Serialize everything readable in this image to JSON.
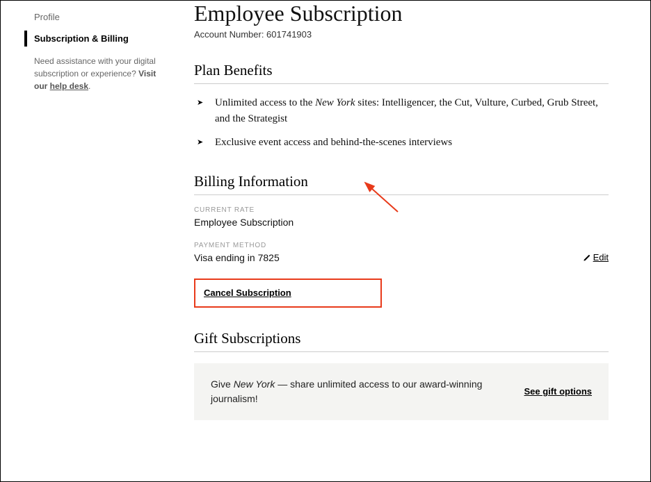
{
  "sidebar": {
    "items": [
      {
        "label": "Profile"
      },
      {
        "label": "Subscription & Billing"
      }
    ],
    "help_prefix": "Need assistance with your digital subscription or experience? ",
    "help_bold": "Visit our ",
    "help_link": "help desk"
  },
  "page": {
    "title": "Employee Subscription",
    "account_label": "Account Number: ",
    "account_number": "601741903"
  },
  "benefits": {
    "heading": "Plan Benefits",
    "items": [
      {
        "prefix": "Unlimited access to the ",
        "em": "New York",
        "suffix": " sites: Intelligencer, the Cut, Vulture, Curbed, Grub Street, and the Strategist"
      },
      {
        "prefix": "Exclusive event access and behind-the-scenes interviews",
        "em": "",
        "suffix": ""
      }
    ]
  },
  "billing": {
    "heading": "Billing Information",
    "rate_label": "CURRENT RATE",
    "rate_value": "Employee Subscription",
    "payment_label": "PAYMENT METHOD",
    "payment_value": "Visa ending in 7825",
    "edit_label": "Edit",
    "cancel_label": "Cancel Subscription"
  },
  "gift": {
    "heading": "Gift Subscriptions",
    "text_prefix": "Give ",
    "text_em": "New York",
    "text_suffix": " — share unlimited access to our award-winning journalism!",
    "options_label": "See gift options"
  },
  "annotation": {
    "arrow_color": "#e83a1a"
  }
}
